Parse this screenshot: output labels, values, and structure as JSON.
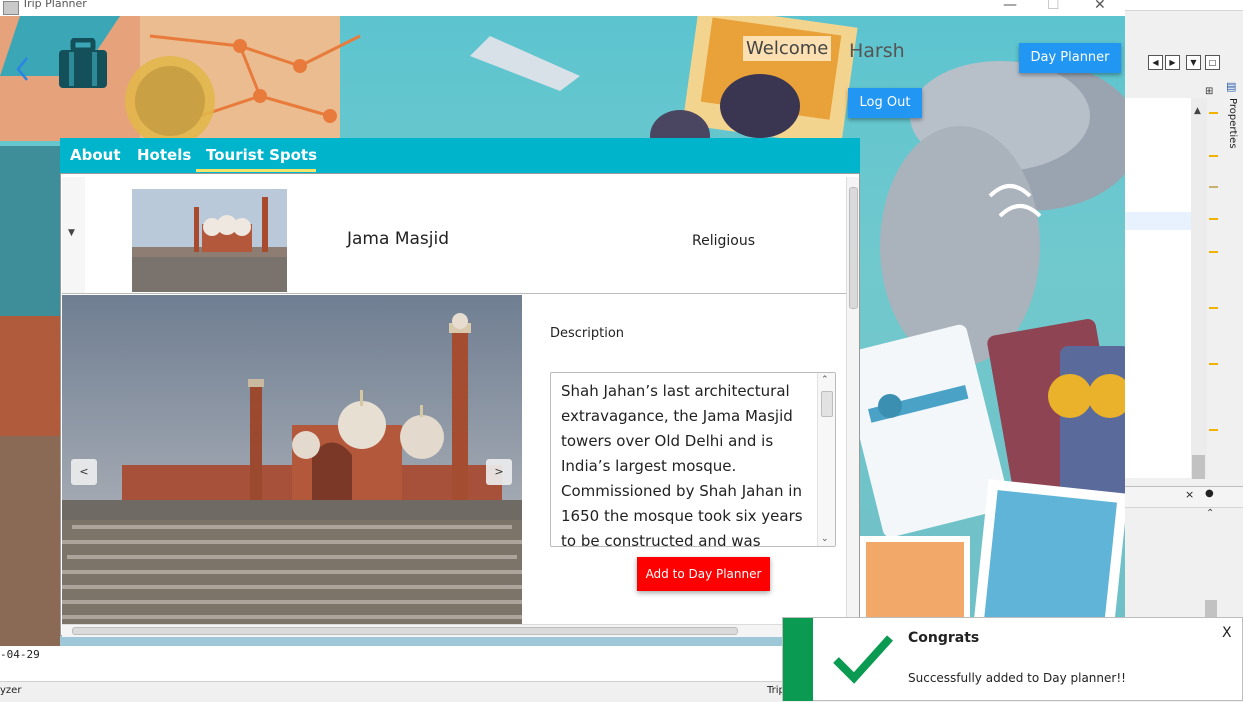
{
  "window": {
    "title": "Trip Planner",
    "minimize_glyph": "—",
    "maximize_glyph": "☐",
    "close_glyph": "✕"
  },
  "header": {
    "welcome_label": "Welcome",
    "username": "Harsh",
    "day_planner_button": "Day Planner",
    "logout_button": "Log Out",
    "back_icon": "chevron-left-icon",
    "logo_icon": "suitcase-icon"
  },
  "tabs": [
    {
      "label": "About"
    },
    {
      "label": "Hotels"
    },
    {
      "label": "Tourist Spots",
      "active": true
    }
  ],
  "spot": {
    "name": "Jama Masjid",
    "category": "Religious",
    "description_label": "Description",
    "description": "Shah Jahan’s last architectural extravagance, the Jama Masjid towers over Old Delhi and is India’s largest mosque. Commissioned by Shah Jahan in 1650 the mosque took six years to be constructed and was",
    "add_button": "Add to Day Planner",
    "prev_label": "<",
    "next_label": ">"
  },
  "toast": {
    "title": "Congrats",
    "message": "Successfully added to Day planner!!",
    "close_label": "X",
    "icon": "checkmark-icon"
  },
  "ide": {
    "date_text": "-04-29",
    "status_left": "yzer",
    "status_right": "Trip",
    "properties_label": "Properties"
  },
  "colors": {
    "accent_blue": "#2196f3",
    "tab_bar": "#00b4cc",
    "add_button": "#ff0000",
    "toast_success": "#0a9a52"
  }
}
